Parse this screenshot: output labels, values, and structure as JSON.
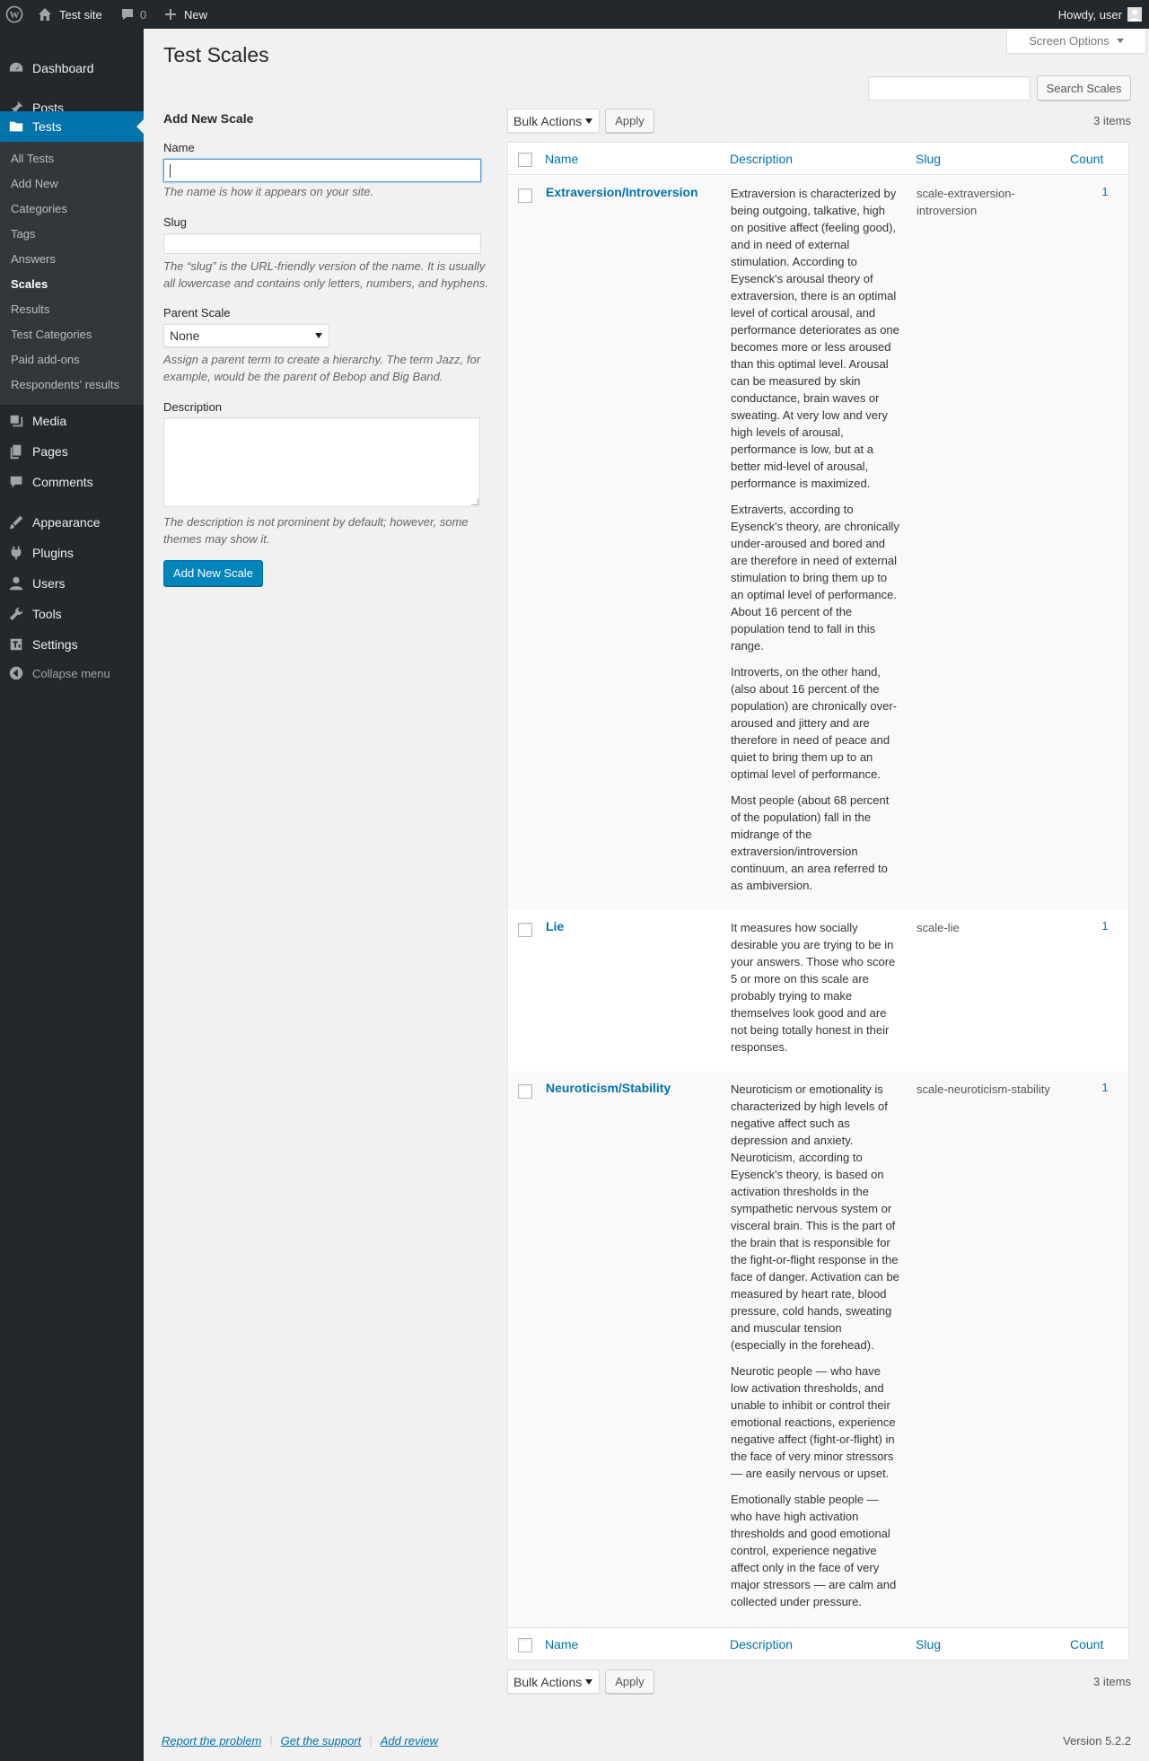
{
  "adminbar": {
    "site_name": "Test site",
    "comments_count": "0",
    "new_label": "New",
    "howdy": "Howdy, user"
  },
  "sidebar": {
    "dashboard": "Dashboard",
    "posts": "Posts",
    "tests": "Tests",
    "submenu": [
      "All Tests",
      "Add New",
      "Categories",
      "Tags",
      "Answers",
      "Scales",
      "Results",
      "Test Categories",
      "Paid add-ons",
      "Respondents' results"
    ],
    "media": "Media",
    "pages": "Pages",
    "comments": "Comments",
    "appearance": "Appearance",
    "plugins": "Plugins",
    "users": "Users",
    "tools": "Tools",
    "settings": "Settings",
    "collapse": "Collapse menu"
  },
  "screen_options": "Screen Options",
  "page_title": "Test Scales",
  "search": {
    "button": "Search Scales",
    "value": ""
  },
  "form": {
    "heading": "Add New Scale",
    "name_label": "Name",
    "name_help": "The name is how it appears on your site.",
    "slug_label": "Slug",
    "slug_help": "The “slug” is the URL-friendly version of the name. It is usually all lowercase and contains only letters, numbers, and hyphens.",
    "parent_label": "Parent Scale",
    "parent_value": "None",
    "parent_help": "Assign a parent term to create a hierarchy. The term Jazz, for example, would be the parent of Bebop and Big Band.",
    "desc_label": "Description",
    "desc_help": "The description is not prominent by default; however, some themes may show it.",
    "submit": "Add New Scale"
  },
  "bulk": {
    "label": "Bulk Actions",
    "apply": "Apply",
    "items": "3 items"
  },
  "table": {
    "columns": {
      "name": "Name",
      "description": "Description",
      "slug": "Slug",
      "count": "Count"
    },
    "rows": [
      {
        "name": "Extraversion/Introversion",
        "slug": "scale-extraversion-introversion",
        "count": "1",
        "desc": [
          "Extraversion is characterized by being outgoing, talkative, high on positive affect (feeling good), and in need of external stimulation. According to Eysenck's arousal theory of extraversion, there is an optimal level of cortical arousal, and performance deteriorates as one becomes more or less aroused than this optimal level. Arousal can be measured by skin conductance, brain waves or sweating. At very low and very high levels of arousal, performance is low, but at a better mid-level of arousal, performance is maximized.",
          "Extraverts, according to Eysenck's theory, are chronically under-aroused and bored and are therefore in need of external stimulation to bring them up to an optimal level of performance. About 16 percent of the population tend to fall in this range.",
          "Introverts, on the other hand, (also about 16 percent of the population) are chronically over-aroused and jittery and are therefore in need of peace and quiet to bring them up to an optimal level of performance.",
          "Most people (about 68 percent of the population) fall in the midrange of the extraversion/introversion continuum, an area referred to as ambiversion."
        ]
      },
      {
        "name": "Lie",
        "slug": "scale-lie",
        "count": "1",
        "desc": [
          "It measures how socially desirable you are trying to be in your answers. Those who score 5 or more on this scale are probably trying to make themselves look good and are not being totally honest in their responses."
        ]
      },
      {
        "name": "Neuroticism/Stability",
        "slug": "scale-neuroticism-stability",
        "count": "1",
        "desc": [
          "Neuroticism or emotionality is characterized by high levels of negative affect such as depression and anxiety. Neuroticism, according to Eysenck's theory, is based on activation thresholds in the sympathetic nervous system or visceral brain. This is the part of the brain that is responsible for the fight-or-flight response in the face of danger. Activation can be measured by heart rate, blood pressure, cold hands, sweating and muscular tension (especially in the forehead).",
          "Neurotic people — who have low activation thresholds, and unable to inhibit or control their emotional reactions, experience negative affect (fight-or-flight) in the face of very minor stressors — are easily nervous or upset.",
          "Emotionally stable people — who have high activation thresholds and good emotional control, experience negative affect only in the face of very major stressors — are calm and collected under pressure."
        ]
      }
    ]
  },
  "footer": {
    "report": "Report the problem",
    "support": "Get the support",
    "review": "Add review",
    "version": "Version 5.2.2"
  },
  "colors": {
    "sidebar": "#23282d",
    "submenu": "#32373c",
    "accent": "#0073aa",
    "primary_button": "#0085ba",
    "background": "#f1f1f1"
  },
  "icons": [
    "wordpress-logo-icon",
    "home-icon",
    "comment-bubble-icon",
    "plus-icon",
    "avatar-icon",
    "dashboard-icon",
    "pushpin-icon",
    "folder-icon",
    "media-icon",
    "pages-icon",
    "comments-icon",
    "appearance-icon",
    "plugins-icon",
    "users-icon",
    "tools-icon",
    "settings-icon",
    "collapse-icon"
  ]
}
